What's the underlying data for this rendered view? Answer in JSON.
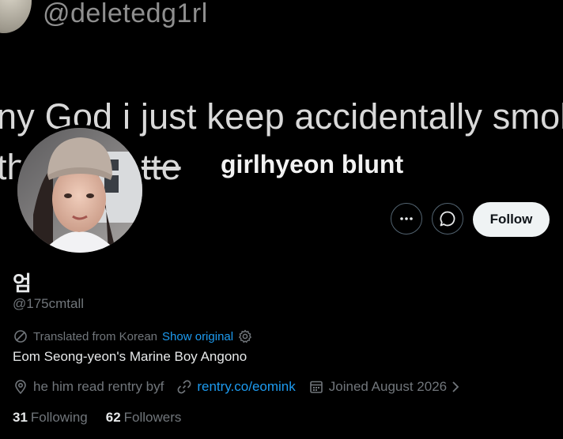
{
  "banner": {
    "handle": "@deletedg1rl",
    "line1": "ny God i just keep accidentally smok",
    "line2_prefix": "th",
    "line2_struck": "ette",
    "line2_bold": "girlhyeon blunt"
  },
  "actions": {
    "follow_label": "Follow"
  },
  "profile": {
    "display_name": "엄",
    "handle": "@175cmtall",
    "translated_label": "Translated from Korean",
    "show_original_label": "Show original",
    "bio": "Eom Seong-yeon's Marine Boy Angono",
    "location": "he him read rentry byf",
    "website": "rentry.co/eomink",
    "joined": "Joined August 2026",
    "following_count": "31",
    "following_label": "Following",
    "followers_count": "62",
    "followers_label": "Followers"
  },
  "colors": {
    "background": "#000000",
    "text_primary": "#e7e9ea",
    "text_muted": "#71767b",
    "link": "#1d9bf0",
    "follow_button_bg": "#eff3f4",
    "button_border": "#536471"
  },
  "icons": [
    "more-dots-icon",
    "message-icon",
    "translate-icon",
    "gear-icon",
    "location-pin-icon",
    "link-icon",
    "calendar-icon",
    "chevron-right-icon"
  ]
}
